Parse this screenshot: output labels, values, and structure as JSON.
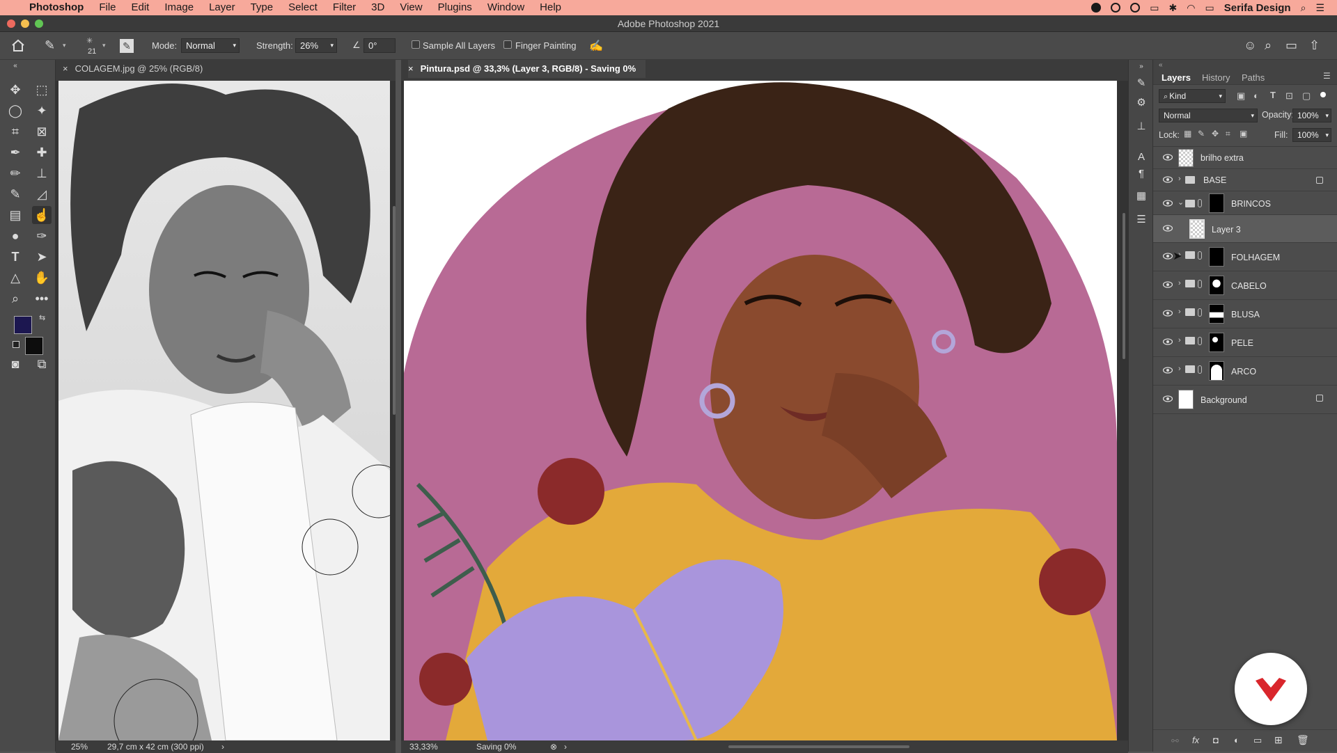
{
  "menubar": {
    "app": "Photoshop",
    "items": [
      "File",
      "Edit",
      "Image",
      "Layer",
      "Type",
      "Select",
      "Filter",
      "3D",
      "View",
      "Plugins",
      "Window",
      "Help"
    ],
    "account": "Serifa Design"
  },
  "window": {
    "title": "Adobe Photoshop 2021"
  },
  "options": {
    "brush_size": "21",
    "mode_label": "Mode:",
    "mode_value": "Normal",
    "strength_label": "Strength:",
    "strength_value": "26%",
    "angle_value": "0°",
    "sample_all_layers": "Sample All Layers",
    "finger_painting": "Finger Painting"
  },
  "docs": [
    {
      "tab": "COLAGEM.jpg @ 25% (RGB/8)",
      "zoom": "25%",
      "info": "29,7 cm x 42 cm (300 ppi)"
    },
    {
      "tab": "Pintura.psd @ 33,3% (Layer 3, RGB/8) - Saving 0%",
      "zoom": "33,33%",
      "info": "Saving 0%"
    }
  ],
  "panel": {
    "tabs": [
      "Layers",
      "History",
      "Paths"
    ],
    "filter_kind": "Kind",
    "blend_mode": "Normal",
    "opacity_label": "Opacity:",
    "opacity_value": "100%",
    "lock_label": "Lock:",
    "fill_label": "Fill:",
    "fill_value": "100%"
  },
  "layers": [
    {
      "name": "brilho extra",
      "kind": "layer",
      "visible": true
    },
    {
      "name": "BASE",
      "kind": "group",
      "visible": true,
      "locked": true
    },
    {
      "name": "BRINCOS",
      "kind": "group-open",
      "visible": true
    },
    {
      "name": "Layer 3",
      "kind": "layer",
      "visible": true,
      "selected": true
    },
    {
      "name": "FOLHAGEM",
      "kind": "group",
      "visible": true
    },
    {
      "name": "CABELO",
      "kind": "group",
      "visible": true
    },
    {
      "name": "BLUSA",
      "kind": "group",
      "visible": true
    },
    {
      "name": "PELE",
      "kind": "group",
      "visible": true
    },
    {
      "name": "ARCO",
      "kind": "group",
      "visible": true
    },
    {
      "name": "Background",
      "kind": "background",
      "visible": true,
      "locked": true
    }
  ],
  "colors": {
    "menubar": "#f7a99b",
    "foreground_swatch": "#1c1750",
    "background_swatch": "#0d0d0d",
    "canvas_bg": "#b86a95",
    "logo": "#d9262c"
  }
}
